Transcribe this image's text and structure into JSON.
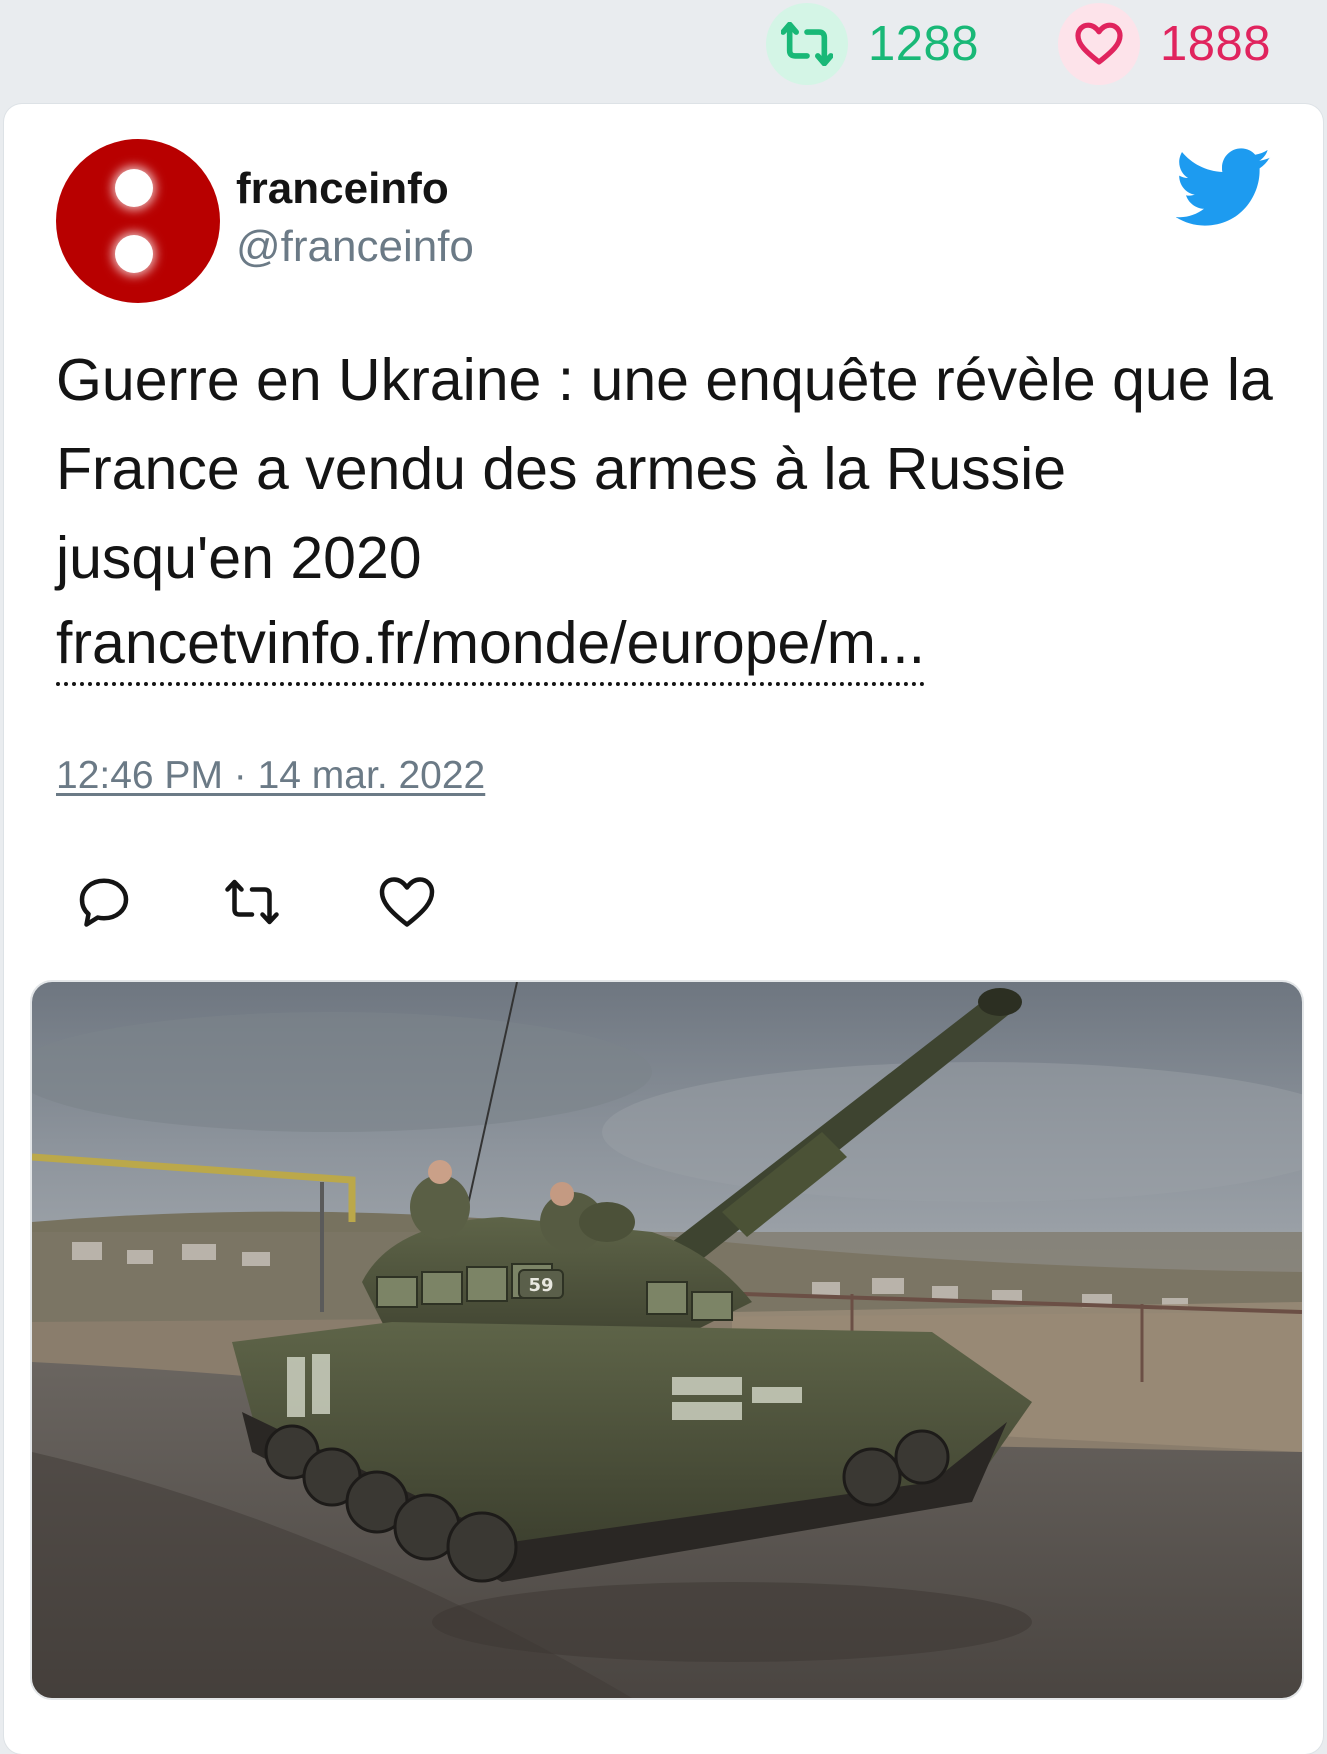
{
  "stats": {
    "retweet_count": "1288",
    "like_count": "1888",
    "retweet_color": "#19b877",
    "like_color": "#e0245e"
  },
  "tweet": {
    "display_name": "franceinfo",
    "handle": "@franceinfo",
    "text": "Guerre en Ukraine : une enquête révèle que la France a vendu des armes à la Russie jusqu'en 2020",
    "link": "francetvinfo.fr/monde/europe/m...",
    "timestamp": "12:46 PM · 14 mar. 2022"
  },
  "actions": {
    "reply_icon": "reply-icon",
    "retweet_icon": "retweet-icon",
    "like_icon": "heart-icon"
  },
  "media": {
    "image_description_icon": "photo",
    "tank_number": "59"
  },
  "brand": {
    "twitter_color": "#1d9bf0",
    "avatar_color": "#b80000"
  }
}
